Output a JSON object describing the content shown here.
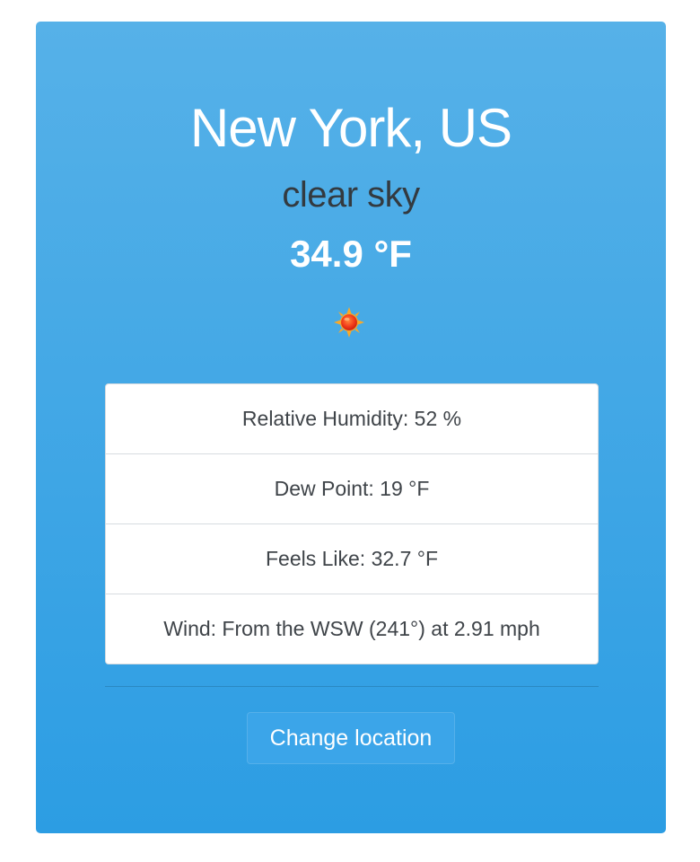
{
  "weather": {
    "location": "New York, US",
    "condition": "clear sky",
    "temperature": "34.9 °F",
    "icon": "sun-icon"
  },
  "details": [
    {
      "label": "Relative Humidity: 52 %"
    },
    {
      "label": "Dew Point: 19 °F"
    },
    {
      "label": "Feels Like: 32.7 °F"
    },
    {
      "label": "Wind: From the WSW (241°) at 2.91 mph"
    }
  ],
  "actions": {
    "change_location_label": "Change location"
  },
  "colors": {
    "card_top": "#56b1e8",
    "card_bottom": "#2c9de3",
    "button": "#3ba5e9",
    "condition_text": "#333a40"
  }
}
